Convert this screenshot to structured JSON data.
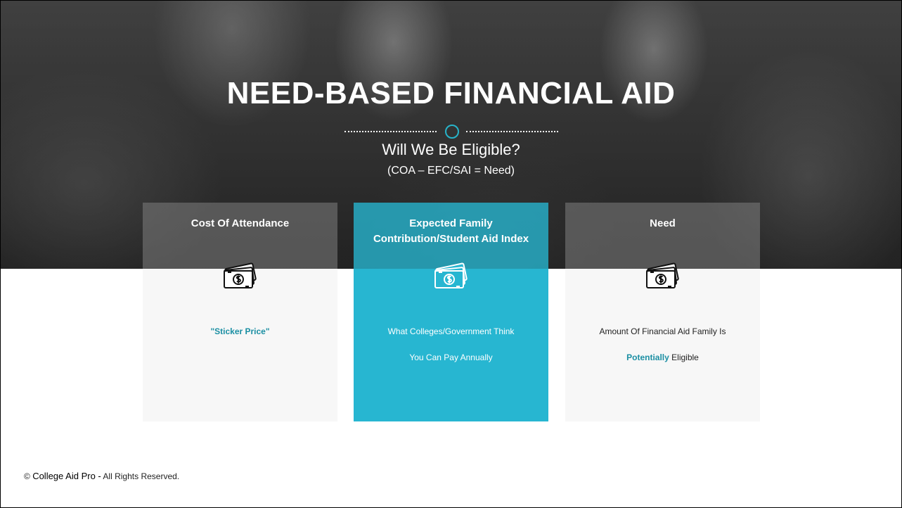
{
  "slide": {
    "title": "NEED-BASED FINANCIAL AID",
    "subtitle": "Will We Be Eligible?",
    "formula": "(COA – EFC/SAI = Need)"
  },
  "cards": [
    {
      "heading": "Cost Of Attendance",
      "icon": "money-bill-icon",
      "body": "\"Sticker Price\""
    },
    {
      "heading": "Expected Family Contribution/Student Aid Index",
      "icon": "money-bill-icon",
      "body_line1": "What Colleges/Government Think",
      "body_line2": "You Can Pay Annually"
    },
    {
      "heading": "Need",
      "icon": "money-bill-icon",
      "body_line1": "Amount Of Financial Aid Family Is",
      "body_accent": "Potentially",
      "body_tail": "Eligible"
    }
  ],
  "footer": {
    "copyright": "©",
    "brand": "College Aid Pro -",
    "rights": "All Rights Reserved."
  },
  "colors": {
    "accent": "#27b6d1",
    "accent_text": "#1b8fa3",
    "card_gray": "#f7f7f7"
  }
}
